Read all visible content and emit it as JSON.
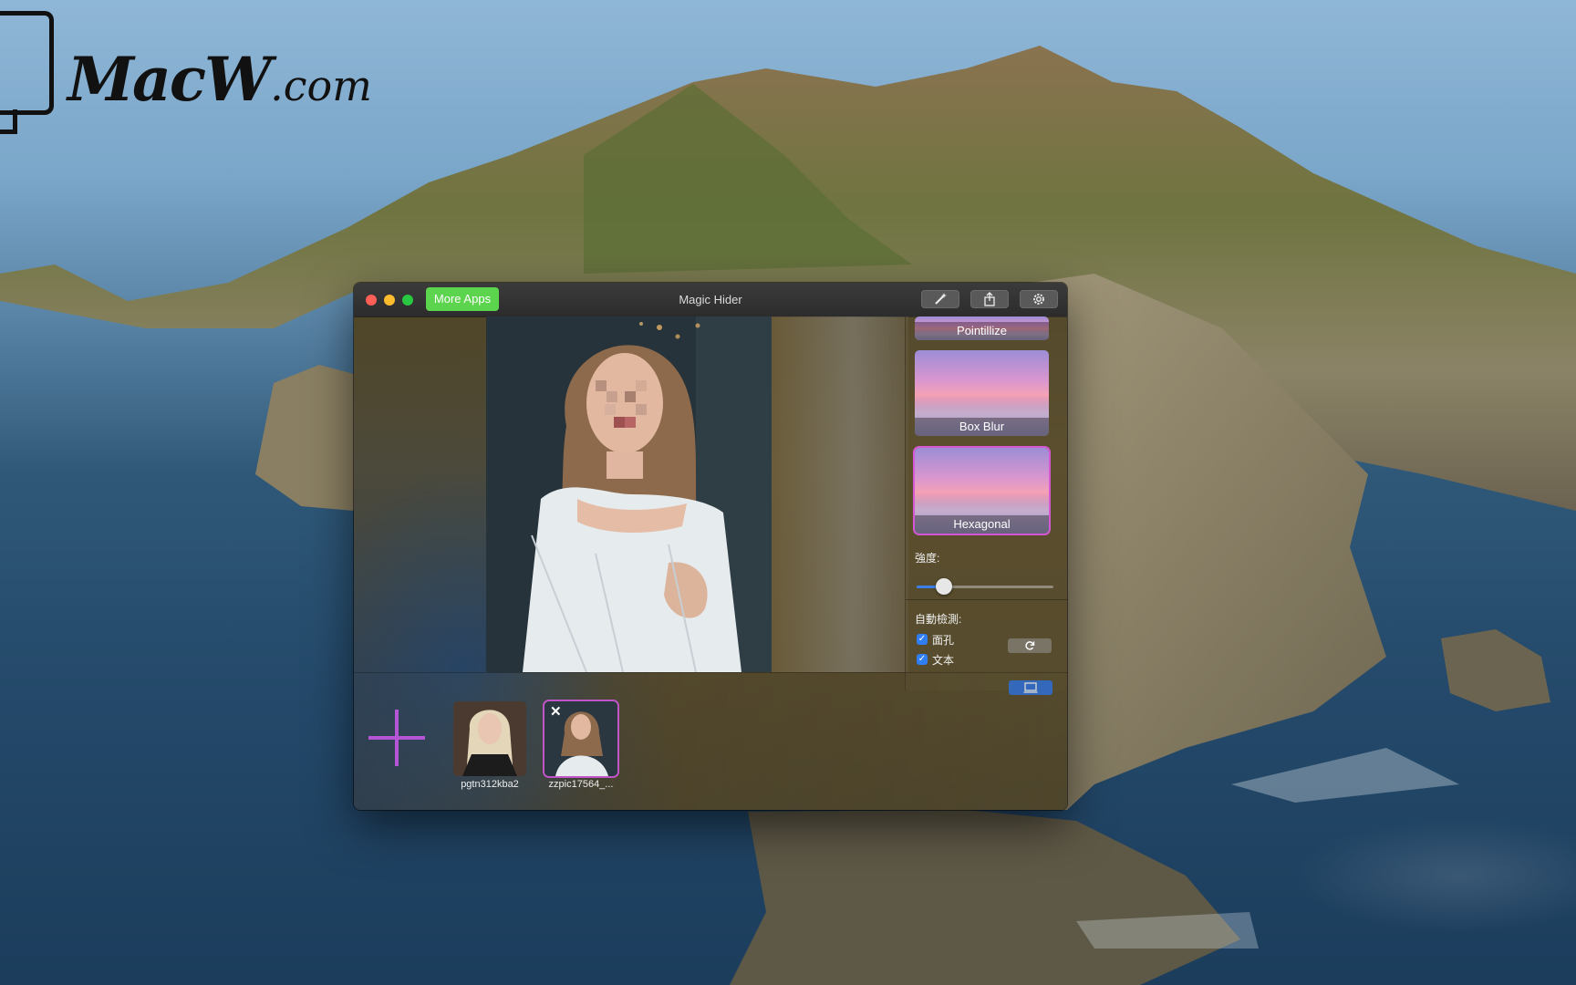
{
  "watermark": {
    "brand_main": "MacW",
    "brand_suffix": ".com"
  },
  "window": {
    "title": "Magic Hider",
    "more_apps_label": "More Apps",
    "toolbar_icons": [
      "magic-wand-icon",
      "share-icon",
      "gear-icon"
    ]
  },
  "effects": [
    {
      "label": "Pointillize"
    },
    {
      "label": "Box Blur"
    },
    {
      "label": "Hexagonal",
      "selected": true
    }
  ],
  "intensity": {
    "label": "強度:",
    "value_fraction": 0.2
  },
  "auto_detect": {
    "label": "自動檢測:",
    "face": {
      "label": "面孔",
      "checked": true
    },
    "text": {
      "label": "文本",
      "checked": true
    }
  },
  "files": [
    {
      "name": "pgtn312kba2",
      "selected": false
    },
    {
      "name": "zzpic17564_...",
      "selected": true
    }
  ],
  "colors": {
    "accent": "#2f7ef3",
    "selection": "#d657d3",
    "more_apps": "#5dd44e"
  }
}
